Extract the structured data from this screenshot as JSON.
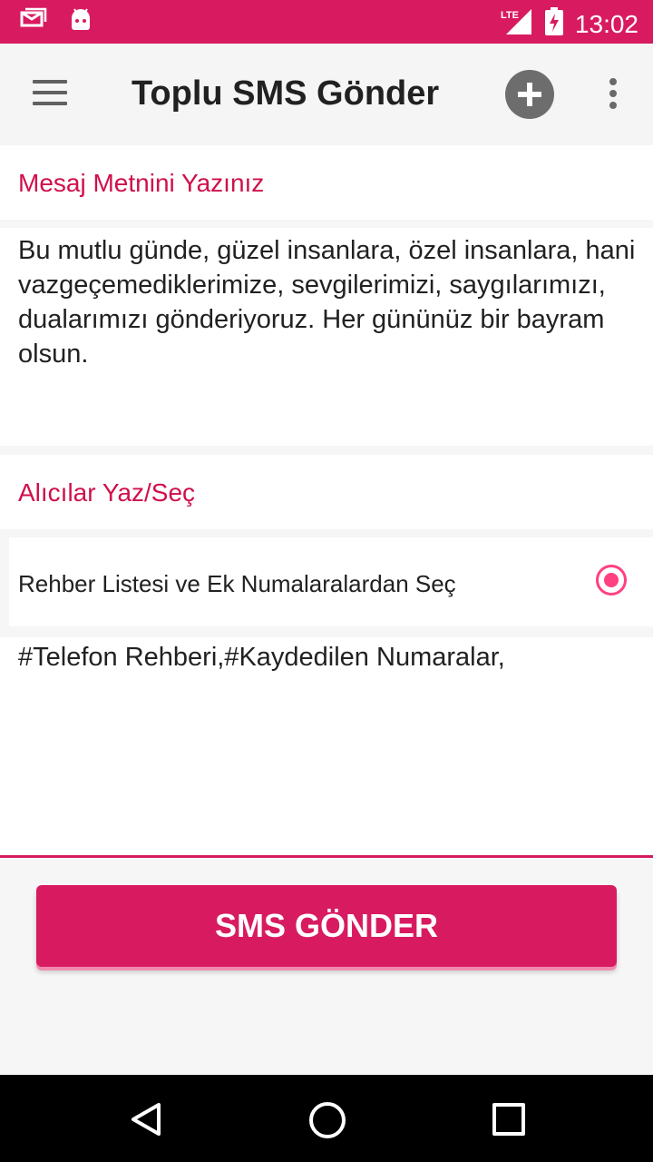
{
  "status_bar": {
    "time": "13:02",
    "network": "LTE",
    "icons": [
      "message-icon",
      "android-icon",
      "lte-signal-icon",
      "battery-charging-icon"
    ]
  },
  "app_bar": {
    "title": "Toplu SMS Gönder",
    "menu_icon": "hamburger-menu-icon",
    "add_icon": "add-circle-icon",
    "overflow_icon": "more-vertical-icon"
  },
  "message_section": {
    "label": "Mesaj Metnini Yazınız",
    "text": "Bu mutlu günde, güzel insanlara, özel insanlara, hani vazgeçemediklerimize, sevgilerimizi, saygılarımızı, dualarımızı gönderiyoruz. Her gününüz bir bayram olsun."
  },
  "recipients_section": {
    "label": "Alıcılar Yaz/Seç",
    "option_label": "Rehber Listesi ve Ek Numalaralardan Seç",
    "option_selected": true,
    "text": "#Telefon Rehberi,#Kaydedilen Numaralar,"
  },
  "send_button": {
    "label": "SMS GÖNDER"
  },
  "colors": {
    "primary": "#d81b60",
    "accent": "#ff4081",
    "label": "#d0104b"
  }
}
